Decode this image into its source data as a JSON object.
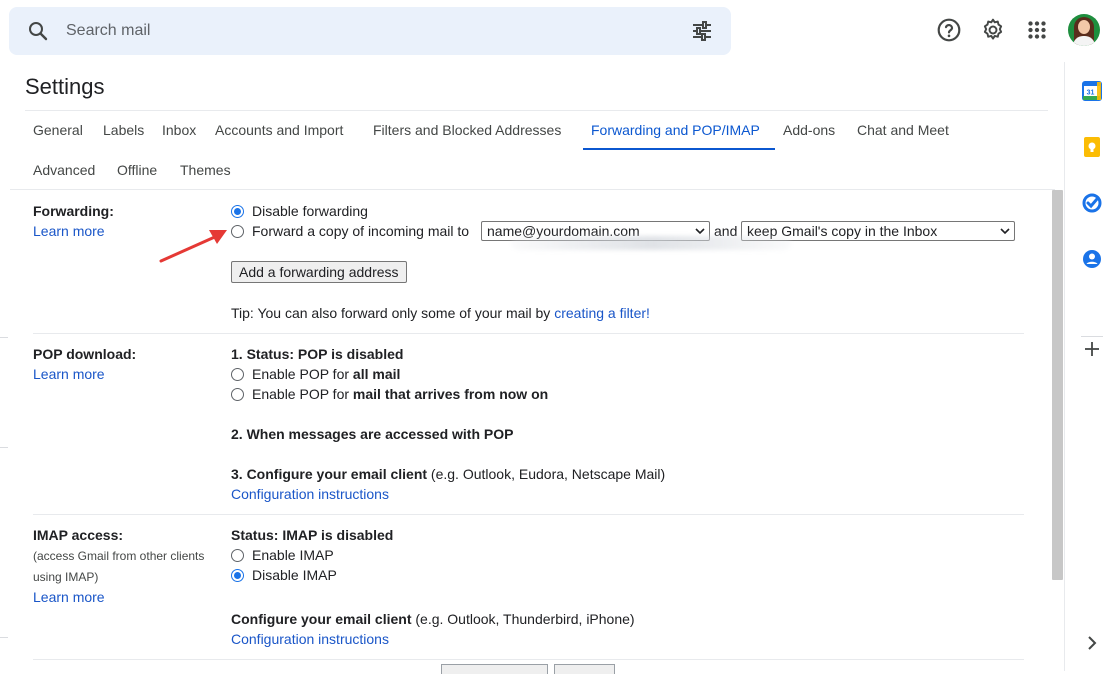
{
  "search": {
    "placeholder": "Search mail",
    "icon": "search-icon",
    "filter_icon": "tune-icon"
  },
  "header_icons": [
    "help-icon",
    "gear-icon",
    "apps-grid-icon",
    "avatar"
  ],
  "page_title": "Settings",
  "tabs": [
    {
      "label": "General"
    },
    {
      "label": "Labels"
    },
    {
      "label": "Inbox"
    },
    {
      "label": "Accounts and Import"
    },
    {
      "label": "Filters and Blocked Addresses"
    },
    {
      "label": "Forwarding and POP/IMAP",
      "active": true
    },
    {
      "label": "Add-ons"
    },
    {
      "label": "Chat and Meet"
    },
    {
      "label": "Advanced"
    },
    {
      "label": "Offline"
    },
    {
      "label": "Themes"
    }
  ],
  "forwarding": {
    "label": "Forwarding:",
    "learn_more": "Learn more",
    "disable_option": "Disable forwarding",
    "forward_option": "Forward a copy of incoming mail to",
    "address_select": "name@yourdomain.com",
    "and_text": "and",
    "action_select": "keep Gmail's copy in the Inbox",
    "add_button": "Add a forwarding address",
    "tip_prefix": "Tip: You can also forward only some of your mail by ",
    "tip_link": "creating a filter!"
  },
  "pop": {
    "label": "POP download:",
    "learn_more": "Learn more",
    "status": "1. Status: POP is disabled",
    "opt_all_prefix": "Enable POP for ",
    "opt_all_bold": "all mail",
    "opt_now_prefix": "Enable POP for ",
    "opt_now_bold": "mail that arrives from now on",
    "accessed_heading": "2. When messages are accessed with POP",
    "configure_heading": "3. Configure your email client",
    "configure_note": " (e.g. Outlook, Eudora, Netscape Mail)",
    "config_link": "Configuration instructions"
  },
  "imap": {
    "label": "IMAP access:",
    "sub1": "(access Gmail from other clients",
    "sub2": "using IMAP)",
    "learn_more": "Learn more",
    "status": "Status: IMAP is disabled",
    "enable": "Enable IMAP",
    "disable": "Disable IMAP",
    "configure_heading": "Configure your email client",
    "configure_note": " (e.g. Outlook, Thunderbird, iPhone)",
    "config_link": "Configuration instructions"
  },
  "side_panel": [
    "calendar-icon",
    "keep-icon",
    "tasks-icon",
    "contacts-icon",
    "plus-icon",
    "chevron-right-icon"
  ],
  "colors": {
    "accent": "#0b57d0",
    "link": "#1a56c8",
    "arrow": "#e53935"
  }
}
